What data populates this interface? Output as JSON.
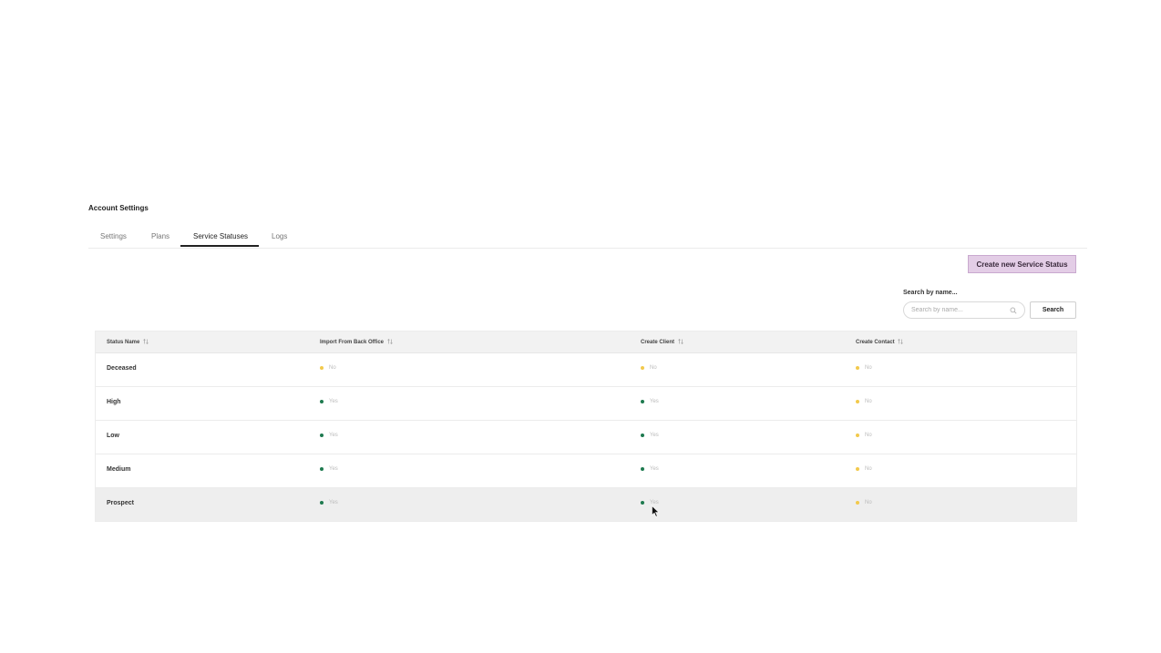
{
  "page": {
    "title": "Account Settings"
  },
  "tabs": [
    {
      "label": "Settings",
      "active": false
    },
    {
      "label": "Plans",
      "active": false
    },
    {
      "label": "Service Statuses",
      "active": true
    },
    {
      "label": "Logs",
      "active": false
    }
  ],
  "toolbar": {
    "create_label": "Create new Service Status",
    "search_label": "Search by name...",
    "search_placeholder": "Search by name...",
    "search_value": "",
    "search_button": "Search"
  },
  "table": {
    "columns": [
      "Status Name",
      "Import From Back Office",
      "Create Client",
      "Create Contact"
    ],
    "rows": [
      {
        "name": "Deceased",
        "import": "No",
        "client": "No",
        "contact": "No"
      },
      {
        "name": "High",
        "import": "Yes",
        "client": "Yes",
        "contact": "No"
      },
      {
        "name": "Low",
        "import": "Yes",
        "client": "Yes",
        "contact": "No"
      },
      {
        "name": "Medium",
        "import": "Yes",
        "client": "Yes",
        "contact": "No"
      },
      {
        "name": "Prospect",
        "import": "Yes",
        "client": "Yes",
        "contact": "No"
      }
    ]
  },
  "colors": {
    "yes": "#1e7a4f",
    "no": "#f2c94c",
    "accent_button": "#e3cde6"
  },
  "icons": {
    "search": "search-icon",
    "sort": "sort-arrows-icon",
    "cursor": "mouse-pointer-icon"
  }
}
